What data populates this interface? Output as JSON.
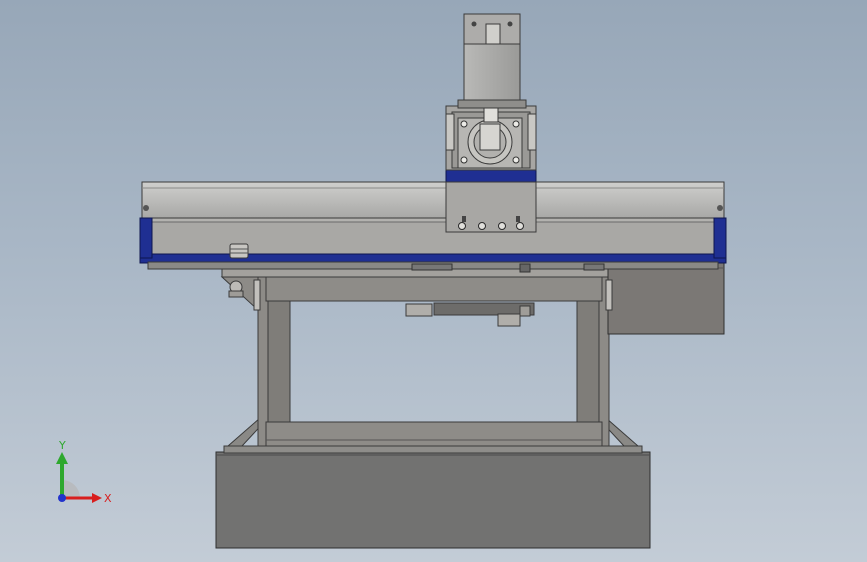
{
  "viewport": {
    "background_top": "#97a7b8",
    "background_bottom": "#c3ccd6"
  },
  "model": {
    "body_color": "#8c8a86",
    "dark_body_color": "#6f6f6e",
    "rail_accent_color": "#1c2a8c",
    "edge_color": "#3a3a3a"
  },
  "triad": {
    "x_label": "X",
    "y_label": "Y",
    "x_color": "#d81e1e",
    "y_color": "#2ea82e",
    "z_color": "#2233cc"
  }
}
